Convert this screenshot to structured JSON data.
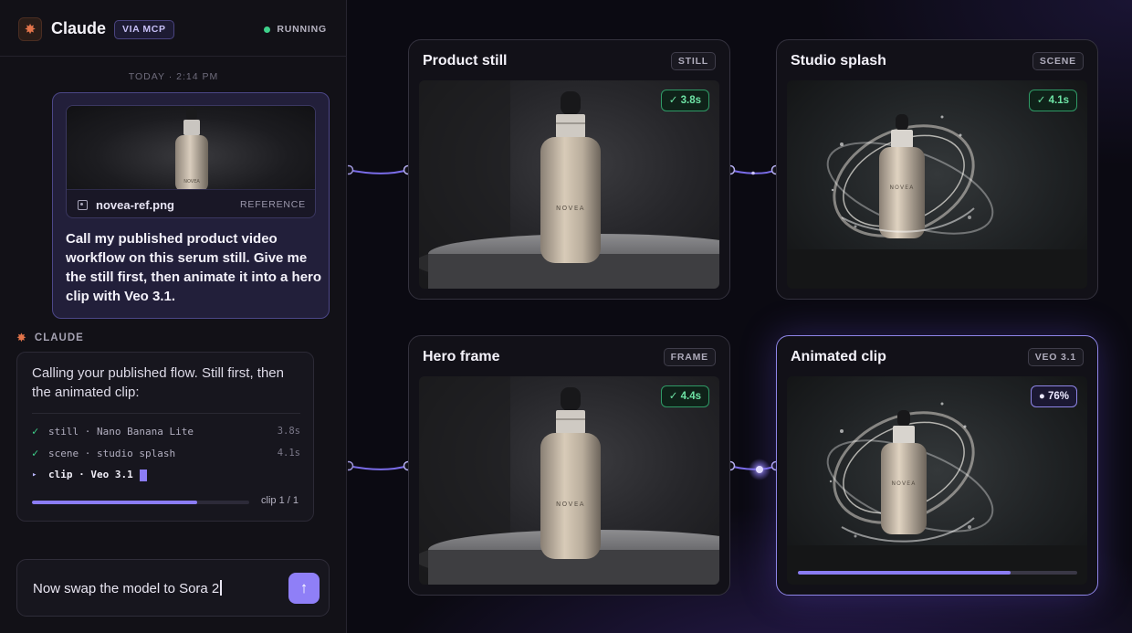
{
  "header": {
    "app_title": "Claude",
    "via_badge": "VIA MCP",
    "status_text": "RUNNING",
    "status_color": "#3ed08a"
  },
  "conversation": {
    "timestamp": "TODAY · 2:14 PM",
    "user_message": {
      "attachment": {
        "file_name": "novea-ref.png",
        "tag": "REFERENCE",
        "label_on_bottle": "NOVEA"
      },
      "text": "Call my published product video workflow on this serum still. Give me the still first, then animate it into a hero clip with Veo 3.1."
    },
    "assistant": {
      "name": "CLAUDE",
      "text": "Calling your published flow. Still first, then the animated clip:",
      "steps": [
        {
          "status": "done",
          "mark": "✓",
          "label": "still · Nano Banana Lite",
          "time": "3.8s"
        },
        {
          "status": "done",
          "mark": "✓",
          "label": "scene · studio splash",
          "time": "4.1s"
        },
        {
          "status": "running",
          "mark": "▸",
          "label": "clip · Veo 3.1",
          "time": ""
        }
      ],
      "progress": 0.76,
      "clip_counter": "clip 1 / 1"
    }
  },
  "composer": {
    "value": "Now swap the model to Sora 2",
    "send_icon": "arrow-up-icon"
  },
  "workflow": {
    "accent_color": "#8b7cf6",
    "nodes": [
      {
        "id": "product-still",
        "title": "Product still",
        "tag": "STILL",
        "badge": "✓ 3.8s",
        "scene": "pedestal",
        "bottle_label": "NOVEA"
      },
      {
        "id": "studio-splash",
        "title": "Studio splash",
        "tag": "SCENE",
        "badge": "✓ 4.1s",
        "scene": "splash",
        "bottle_label": "NOVEA"
      },
      {
        "id": "hero-frame",
        "title": "Hero frame",
        "tag": "FRAME",
        "badge": "✓ 4.4s",
        "scene": "pedestal",
        "bottle_label": "NOVEA"
      },
      {
        "id": "animated-clip",
        "title": "Animated clip",
        "tag": "VEO 3.1",
        "badge": "● 76%",
        "scene": "splash",
        "bottle_label": "NOVEA",
        "progress": 0.76,
        "active": true
      }
    ]
  }
}
